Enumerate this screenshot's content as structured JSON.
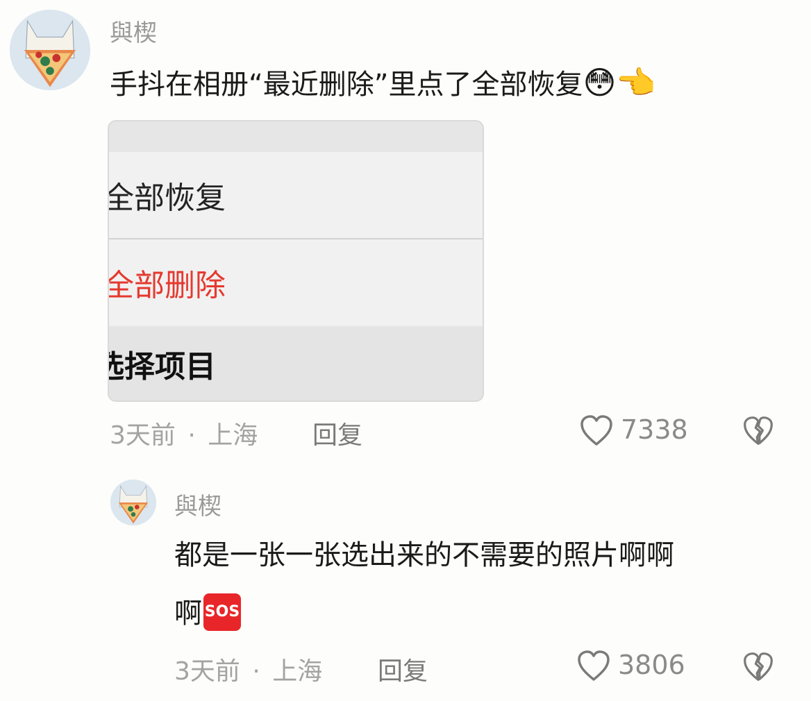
{
  "comments": [
    {
      "username": "與楔",
      "text": "手抖在相册“最近删除”里点了全部恢复",
      "emojis": [
        "😳",
        "👈"
      ],
      "time": "3天前",
      "separator": "·",
      "location": "上海",
      "reply_label": "回复",
      "like_count": "7338",
      "embedded_menu": {
        "restore_all": "全部恢复",
        "delete_all": "全部删除",
        "select_items": "选择项目"
      }
    },
    {
      "username": "與楔",
      "text_line1": "都是一张一张选出来的不需要的照片啊啊",
      "text_line2": "啊",
      "sos_badge": "SOS",
      "time": "3天前",
      "separator": "·",
      "location": "上海",
      "reply_label": "回复",
      "like_count": "3806"
    }
  ],
  "colors": {
    "delete_red": "#e5392e",
    "sos_red": "#e8262a",
    "muted": "#a3a3a3"
  }
}
